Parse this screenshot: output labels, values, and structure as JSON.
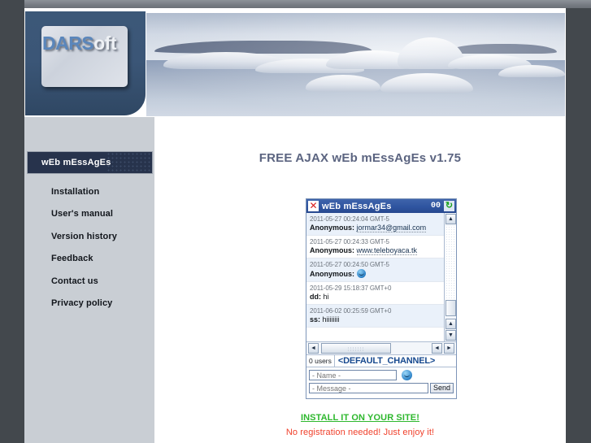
{
  "site": {
    "logo_primary": "DARS",
    "logo_secondary": "oft",
    "banner_alt": "iceberg-lagoon-photo"
  },
  "sidebar": {
    "active_item": "wEb mEssAgEs",
    "items": [
      {
        "label": "Installation"
      },
      {
        "label": "User's manual"
      },
      {
        "label": "Version history"
      },
      {
        "label": "Feedback"
      },
      {
        "label": "Contact us"
      },
      {
        "label": "Privacy policy"
      }
    ]
  },
  "main": {
    "title": "FREE AJAX wEb mEssAgEs v1.75",
    "install_link": "INSTALL IT ON YOUR SITE!",
    "tagline": "No registration needed! Just enjoy it!"
  },
  "chat": {
    "title": "wEb mEssAgEs",
    "close_icon": "✕",
    "refresh_icon": "↻",
    "unread_count": "00",
    "messages": [
      {
        "time": "2011-05-27 00:24:04 GMT-5",
        "user": "Anonymous:",
        "text": "jormar34@gmail.com",
        "kind": "link"
      },
      {
        "time": "2011-05-27 00:24:33 GMT-5",
        "user": "Anonymous:",
        "text": "www.teleboyaca.tk",
        "kind": "link"
      },
      {
        "time": "2011-05-27 00:24:50 GMT-5",
        "user": "Anonymous:",
        "text": "",
        "kind": "emoticon"
      },
      {
        "time": "2011-05-29 15:18:37 GMT+0",
        "user": "dd:",
        "text": "hi",
        "kind": "text"
      },
      {
        "time": "2011-06-02 00:25:59 GMT+0",
        "user": "ss:",
        "text": "hiiiiiiii",
        "kind": "text"
      }
    ],
    "users_count": "0 users",
    "channel": "<DEFAULT_CHANNEL>",
    "name_placeholder": "- Name -",
    "message_placeholder": "- Message -",
    "send_label": "Send",
    "emoticon_icon": "smiley-icon",
    "scroll_up_icon": "▲",
    "scroll_down_icon": "▼",
    "scroll_left_icon": "◄",
    "scroll_right_icon": "►"
  },
  "colors": {
    "header_navy": "#3b5677",
    "sidebar_bg": "#c9ced4",
    "active_nav": "#27334c",
    "title_blue": "#5b6480",
    "chat_titlebar": "#2f55a0",
    "install_green": "#2eb82e",
    "tagline_red": "#f0412c",
    "page_frame": "#43484d"
  }
}
